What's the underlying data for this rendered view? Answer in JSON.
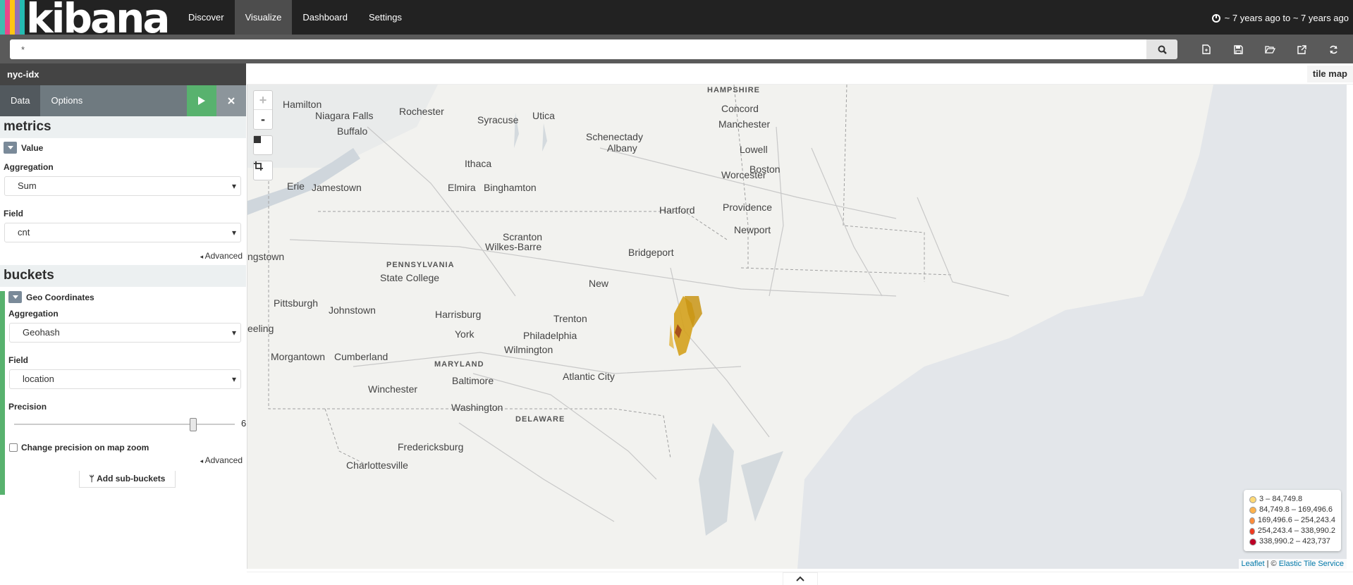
{
  "app": {
    "logo_text": "kibana",
    "logo_colors": [
      "#3ebeb0",
      "#e8488b",
      "#fec514",
      "#9170b8",
      "#24bbb1"
    ]
  },
  "nav": {
    "items": [
      {
        "label": "Discover",
        "active": false
      },
      {
        "label": "Visualize",
        "active": true
      },
      {
        "label": "Dashboard",
        "active": false
      },
      {
        "label": "Settings",
        "active": false
      }
    ],
    "time_range": "~ 7 years ago to ~ 7 years ago"
  },
  "search": {
    "query": "*",
    "search_icon": "search-icon",
    "toolbar_icons": [
      "new-visualization-icon",
      "save-icon",
      "open-icon",
      "share-icon",
      "refresh-icon"
    ]
  },
  "sidebar": {
    "index_pattern": "nyc-idx",
    "tabs": [
      {
        "label": "Data",
        "active": true
      },
      {
        "label": "Options",
        "active": false
      }
    ],
    "metrics": {
      "heading": "metrics",
      "agg_title": "Value",
      "aggregation_label": "Aggregation",
      "aggregation_value": "Sum",
      "field_label": "Field",
      "field_value": "cnt",
      "advanced_label": "Advanced"
    },
    "buckets": {
      "heading": "buckets",
      "agg_title": "Geo Coordinates",
      "aggregation_label": "Aggregation",
      "aggregation_value": "Geohash",
      "field_label": "Field",
      "field_value": "location",
      "precision_label": "Precision",
      "precision_value": 6,
      "precision_max": 7,
      "change_precision_label": "Change precision on map zoom",
      "advanced_label": "Advanced",
      "add_sub_buckets_label": "Add sub-buckets"
    }
  },
  "visualization": {
    "type_label": "tile map",
    "zoom_in": "+",
    "zoom_out": "-",
    "map_labels": [
      "HAMPSHIRE",
      "Hamilton",
      "Niagara Falls",
      "Rochester",
      "Syracuse",
      "Utica",
      "Concord",
      "Manchester",
      "Schenectady",
      "Albany",
      "Buffalo",
      "Lowell",
      "Ithaca",
      "Boston",
      "Worcester",
      "Erie",
      "Jamestown",
      "Elmira",
      "Binghamton",
      "Hartford",
      "Providence",
      "Newport",
      "Scranton",
      "Wilkes-Barre",
      "Bridgeport",
      "ngstown",
      "PENNSYLVANIA",
      "State College",
      "New",
      "Pittsburgh",
      "Johnstown",
      "Harrisburg",
      "Trenton",
      "eeling",
      "York",
      "Philadelphia",
      "Wilmington",
      "Morgantown",
      "Cumberland",
      "MARYLAND",
      "Baltimore",
      "Atlantic City",
      "Winchester",
      "Washington",
      "DELAWARE",
      "Fredericksburg",
      "Charlottesville"
    ],
    "legend": [
      {
        "label": "3 – 84,749.8",
        "color": "#fed976"
      },
      {
        "label": "84,749.8 – 169,496.6",
        "color": "#feb24c"
      },
      {
        "label": "169,496.6 – 254,243.4",
        "color": "#fd8d3c"
      },
      {
        "label": "254,243.4 – 338,990.2",
        "color": "#f03b20"
      },
      {
        "label": "338,990.2 – 423,737",
        "color": "#bd0026"
      }
    ],
    "attribution": {
      "leaflet": "Leaflet",
      "separator": " | © ",
      "service": "Elastic Tile Service"
    },
    "bottom_toggle_icon": "chevron-up-icon"
  }
}
